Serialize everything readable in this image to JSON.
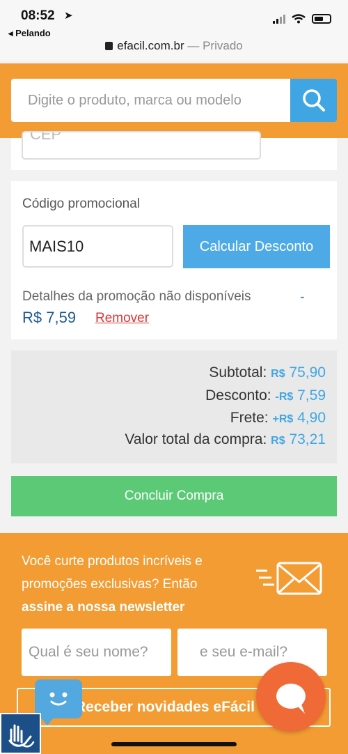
{
  "status": {
    "time": "08:52",
    "back_app": "◂ Pelando"
  },
  "browser": {
    "url": "efacil.com.br",
    "mode": "— Privado"
  },
  "search": {
    "placeholder": "Digite o produto, marca ou modelo"
  },
  "cep": {
    "placeholder": "CEP"
  },
  "promo": {
    "label": "Código promocional",
    "code": "MAIS10",
    "calc_label": "Calcular Desconto",
    "details": "Detalhes da promoção não disponíveis",
    "dash": "-",
    "value": "R$ 7,59",
    "remove": "Remover"
  },
  "summary": {
    "subtotal_label": "Subtotal:",
    "subtotal_cur": "R$",
    "subtotal_value": "75,90",
    "desconto_label": "Desconto:",
    "desconto_cur": "-R$",
    "desconto_value": "7,59",
    "frete_label": "Frete:",
    "frete_cur": "+R$",
    "frete_value": "4,90",
    "total_label": "Valor total da compra:",
    "total_cur": "R$",
    "total_value": "73,21"
  },
  "finish_label": "Concluir Compra",
  "newsletter": {
    "text": "Você curte produtos incríveis e promoções exclusivas? Então",
    "bold": "assine a nossa newsletter",
    "name_placeholder": "Qual é seu nome?",
    "email_placeholder": "e seu e-mail?",
    "submit": "Receber novidades eFácil"
  },
  "colors": {
    "orange": "#f39c33",
    "blue": "#3fa6e3",
    "green": "#5cc977",
    "red_link": "#dd3333",
    "chat_orange": "#ef6a36"
  },
  "icons": [
    "location-arrow-icon",
    "signal-icon",
    "wifi-icon",
    "battery-icon",
    "lock-icon",
    "search-icon",
    "mail-icon",
    "chat-bot-icon",
    "chat-bubble-icon",
    "sign-language-icon"
  ]
}
